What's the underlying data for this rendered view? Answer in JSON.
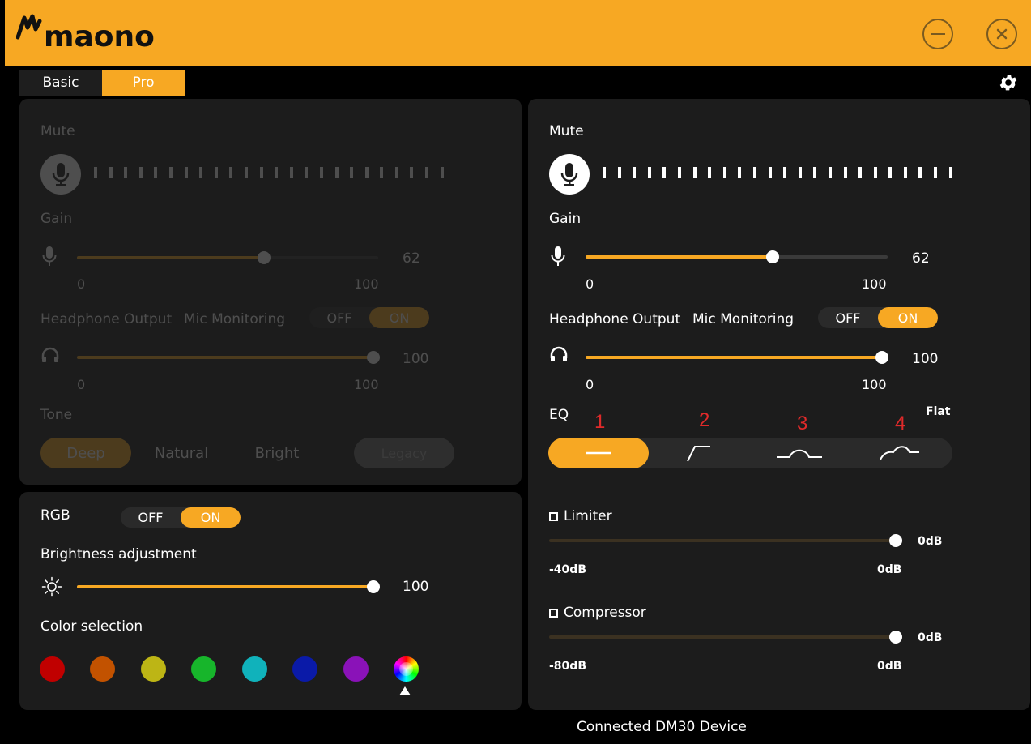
{
  "app": {
    "brand": "maono"
  },
  "tabs": [
    {
      "label": "Basic"
    },
    {
      "label": "Pro"
    }
  ],
  "left": {
    "mute_label": "Mute",
    "gain_label": "Gain",
    "gain_value": "62",
    "gain_min": "0",
    "gain_max": "100",
    "gain_fraction": 0.62,
    "headphone_label": "Headphone Output",
    "monitoring_label": "Mic Monitoring",
    "monitor_off": "OFF",
    "monitor_on": "ON",
    "headphone_value": "100",
    "headphone_min": "0",
    "headphone_max": "100",
    "headphone_fraction": 1.0,
    "tone_label": "Tone",
    "tone_options": [
      "Deep",
      "Natural",
      "Bright"
    ],
    "legacy_label": "Legacy"
  },
  "rgb": {
    "label": "RGB",
    "off": "OFF",
    "on": "ON",
    "brightness_label": "Brightness adjustment",
    "brightness_value": "100",
    "brightness_fraction": 1.0,
    "color_label": "Color selection",
    "colors": [
      "#c00000",
      "#c25200",
      "#bdb515",
      "#17b52b",
      "#10b2bb",
      "#0a1aa8",
      "#8a12b8",
      "rainbow"
    ]
  },
  "right": {
    "mute_label": "Mute",
    "gain_label": "Gain",
    "gain_value": "62",
    "gain_min": "0",
    "gain_max": "100",
    "gain_fraction": 0.62,
    "headphone_label": "Headphone Output",
    "monitoring_label": "Mic Monitoring",
    "monitor_off": "OFF",
    "monitor_on": "ON",
    "headphone_value": "100",
    "headphone_min": "0",
    "headphone_max": "100",
    "headphone_fraction": 1.0,
    "eq_label": "EQ",
    "eq_numbers": [
      "1",
      "2",
      "3",
      "4"
    ],
    "eq_selected_name": "Flat",
    "limiter_label": "Limiter",
    "limiter_value": "0dB",
    "limiter_min": "-40dB",
    "limiter_max": "0dB",
    "compressor_label": "Compressor",
    "compressor_value": "0dB",
    "compressor_min": "-80dB",
    "compressor_max": "0dB"
  },
  "status": {
    "text": "Connected DM30  Device"
  },
  "colors": {
    "accent": "#f7a823",
    "panel": "#1c1c1c",
    "annotation": "#e02a2a"
  }
}
